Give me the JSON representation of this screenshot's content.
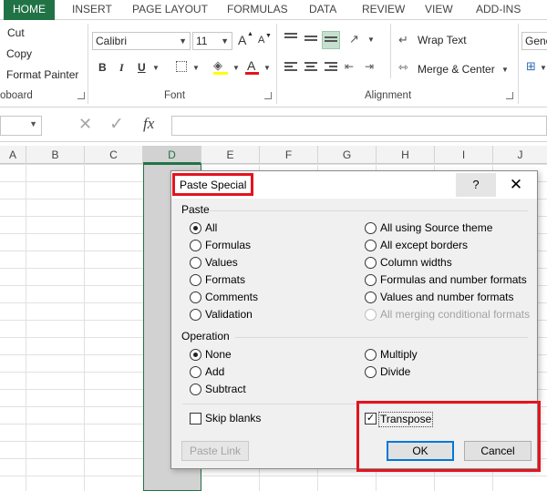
{
  "ribbon_tabs": [
    "HOME",
    "INSERT",
    "PAGE LAYOUT",
    "FORMULAS",
    "DATA",
    "REVIEW",
    "VIEW",
    "ADD-INS"
  ],
  "clipboard": {
    "cut": "Cut",
    "copy": "Copy",
    "format_painter": "Format Painter",
    "label": "oboard"
  },
  "font": {
    "name": "Calibri",
    "size": "11",
    "label": "Font",
    "bold": "B",
    "italic": "I",
    "underline": "U",
    "grow": "A",
    "shrink": "A",
    "font_color_letter": "A"
  },
  "alignment": {
    "wrap_text": "Wrap Text",
    "merge_center": "Merge & Center",
    "label": "Alignment"
  },
  "number": {
    "format": "Gene"
  },
  "formula_bar": {
    "fx": "fx",
    "cancel": "✕",
    "enter": "✓"
  },
  "columns": [
    "A",
    "B",
    "C",
    "D",
    "E",
    "F",
    "G",
    "H",
    "I",
    "J"
  ],
  "dialog": {
    "title": "Paste Special",
    "help": "?",
    "close": "✕",
    "paste_section": "Paste",
    "paste_options_left": [
      {
        "label": "All",
        "selected": true
      },
      {
        "label": "Formulas",
        "selected": false
      },
      {
        "label": "Values",
        "selected": false
      },
      {
        "label": "Formats",
        "selected": false
      },
      {
        "label": "Comments",
        "selected": false
      },
      {
        "label": "Validation",
        "selected": false
      }
    ],
    "paste_options_right": [
      {
        "label": "All using Source theme",
        "selected": false,
        "disabled": false
      },
      {
        "label": "All except borders",
        "selected": false,
        "disabled": false
      },
      {
        "label": "Column widths",
        "selected": false,
        "disabled": false
      },
      {
        "label": "Formulas and number formats",
        "selected": false,
        "disabled": false
      },
      {
        "label": "Values and number formats",
        "selected": false,
        "disabled": false
      },
      {
        "label": "All merging conditional formats",
        "selected": false,
        "disabled": true
      }
    ],
    "operation_section": "Operation",
    "operation_left": [
      {
        "label": "None",
        "selected": true
      },
      {
        "label": "Add",
        "selected": false
      },
      {
        "label": "Subtract",
        "selected": false
      }
    ],
    "operation_right": [
      {
        "label": "Multiply",
        "selected": false
      },
      {
        "label": "Divide",
        "selected": false
      }
    ],
    "skip_blanks": {
      "label": "Skip blanks",
      "checked": false
    },
    "transpose": {
      "label": "Transpose",
      "checked": true
    },
    "paste_link": "Paste Link",
    "ok": "OK",
    "cancel": "Cancel"
  },
  "colors": {
    "accent": "#217346",
    "highlight": "#e3141f"
  }
}
